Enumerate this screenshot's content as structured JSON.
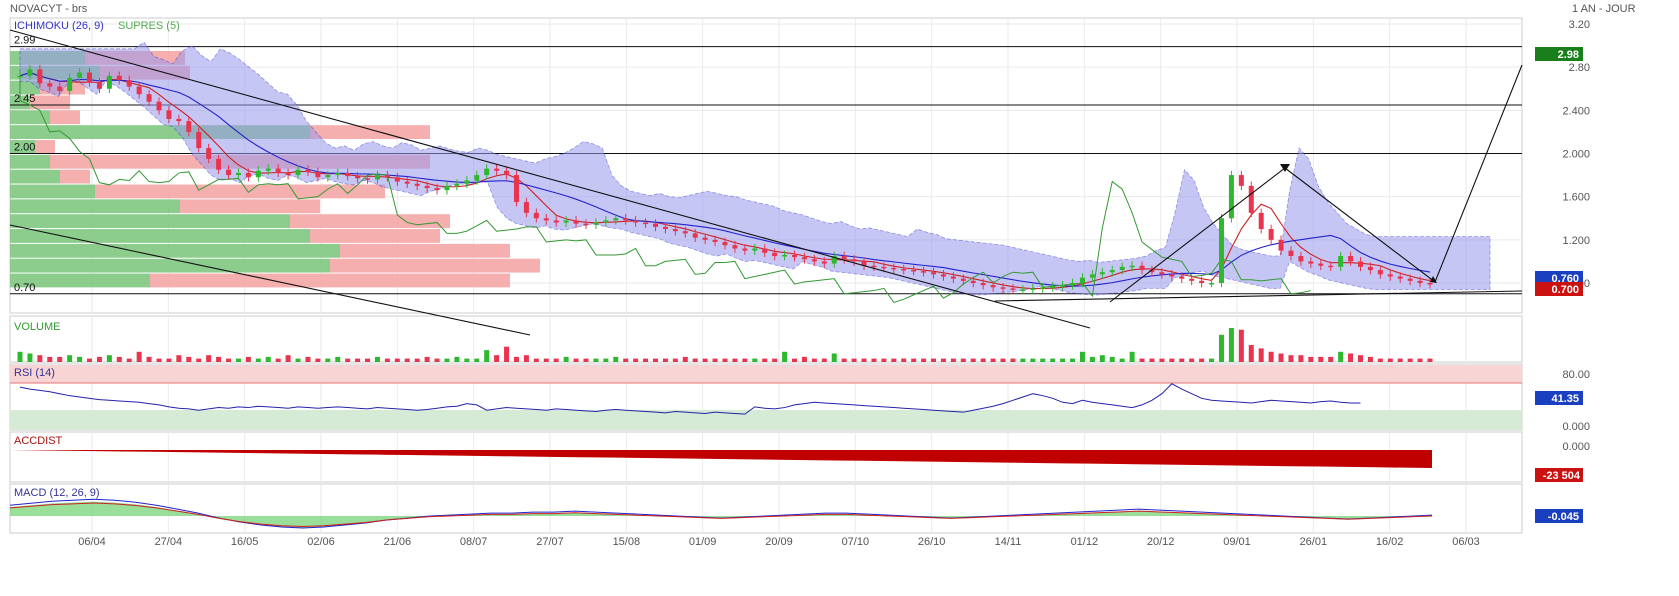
{
  "header": {
    "title": "NOVACYT - brs",
    "period": "1 AN - JOUR"
  },
  "panels": {
    "price": {
      "legend": [
        {
          "label": "ICHIMOKU (26, 9)",
          "color": "#3333cc"
        },
        {
          "label": "SUPRES (5)",
          "color": "#55aa55"
        }
      ],
      "axis_ticks": [
        "3.20",
        "2.80",
        "2.400",
        "2.000",
        "1.600",
        "1.200",
        "0.800"
      ],
      "level_labels": [
        "2.99",
        "2.45",
        "2.00",
        "0.70"
      ],
      "badges": [
        {
          "text": "2.98",
          "color": "#1a7f1a"
        },
        {
          "text": "0.760",
          "color": "#1a3fbf"
        },
        {
          "text": "0.700",
          "color": "#cc1111"
        }
      ]
    },
    "volume": {
      "label": "VOLUME"
    },
    "rsi": {
      "label": "RSI (14)",
      "ticks": [
        "80.00",
        "0.000"
      ],
      "badge": "41.35",
      "badge_color": "#1a3fbf"
    },
    "accdist": {
      "label": "ACCDIST",
      "ticks": [
        "0.000"
      ],
      "badge": "-23 504",
      "badge_color": "#cc1111"
    },
    "macd": {
      "label": "MACD (12, 26, 9)",
      "badge": "-0.045",
      "badge_color": "#1a3fbf"
    }
  },
  "x_axis": {
    "labels": [
      "06/04",
      "27/04",
      "16/05",
      "02/06",
      "21/06",
      "08/07",
      "27/07",
      "15/08",
      "01/09",
      "20/09",
      "07/10",
      "26/10",
      "14/11",
      "01/12",
      "20/12",
      "09/01",
      "26/01",
      "16/02",
      "06/03"
    ]
  },
  "colors": {
    "up": "#2eb82e",
    "down": "#e8344e",
    "cloud": "#9999ee",
    "tenkan": "#cc2222",
    "kijun": "#2222cc",
    "chikou": "#339933",
    "profile_up": "#7fc77f",
    "profile_down": "#f4a6a6"
  },
  "chart_data": {
    "type": "candlestick",
    "title": "NOVACYT - brs",
    "ylim": [
      0.68,
      3.32
    ],
    "close": [
      2.72,
      2.78,
      2.65,
      2.62,
      2.58,
      2.7,
      2.75,
      2.66,
      2.6,
      2.72,
      2.68,
      2.62,
      2.55,
      2.48,
      2.4,
      2.32,
      2.3,
      2.2,
      2.05,
      1.95,
      1.85,
      1.8,
      1.82,
      1.78,
      1.84,
      1.86,
      1.82,
      1.8,
      1.85,
      1.83,
      1.78,
      1.8,
      1.82,
      1.79,
      1.77,
      1.76,
      1.8,
      1.78,
      1.74,
      1.72,
      1.7,
      1.68,
      1.66,
      1.7,
      1.72,
      1.75,
      1.8,
      1.86,
      1.84,
      1.8,
      1.55,
      1.45,
      1.4,
      1.38,
      1.36,
      1.38,
      1.35,
      1.34,
      1.36,
      1.38,
      1.4,
      1.38,
      1.36,
      1.35,
      1.32,
      1.3,
      1.28,
      1.26,
      1.22,
      1.2,
      1.18,
      1.15,
      1.12,
      1.1,
      1.12,
      1.08,
      1.05,
      1.06,
      1.04,
      1.02,
      1.0,
      0.98,
      1.05,
      1.02,
      1.0,
      0.96,
      0.95,
      0.94,
      0.93,
      0.92,
      0.91,
      0.9,
      0.88,
      0.86,
      0.84,
      0.82,
      0.8,
      0.78,
      0.76,
      0.75,
      0.74,
      0.74,
      0.75,
      0.76,
      0.77,
      0.78,
      0.8,
      0.85,
      0.88,
      0.9,
      0.92,
      0.95,
      0.96,
      0.92,
      0.9,
      0.88,
      0.86,
      0.84,
      0.82,
      0.8,
      0.8,
      1.4,
      1.8,
      1.7,
      1.45,
      1.3,
      1.2,
      1.1,
      1.05,
      1.0,
      0.98,
      0.96,
      0.95,
      1.05,
      1.0,
      0.95,
      0.92,
      0.88,
      0.86,
      0.84,
      0.82,
      0.8,
      0.79
    ],
    "volume": [
      0.3,
      0.25,
      0.2,
      0.15,
      0.15,
      0.2,
      0.15,
      0.1,
      0.15,
      0.2,
      0.15,
      0.1,
      0.3,
      0.15,
      0.1,
      0.1,
      0.2,
      0.15,
      0.1,
      0.2,
      0.15,
      0.1,
      0.1,
      0.15,
      0.1,
      0.15,
      0.1,
      0.2,
      0.1,
      0.15,
      0.1,
      0.1,
      0.15,
      0.1,
      0.1,
      0.1,
      0.15,
      0.1,
      0.1,
      0.1,
      0.1,
      0.15,
      0.1,
      0.1,
      0.15,
      0.1,
      0.1,
      0.35,
      0.2,
      0.45,
      0.15,
      0.2,
      0.1,
      0.1,
      0.1,
      0.15,
      0.1,
      0.1,
      0.1,
      0.1,
      0.15,
      0.1,
      0.1,
      0.1,
      0.1,
      0.1,
      0.1,
      0.15,
      0.1,
      0.1,
      0.1,
      0.1,
      0.1,
      0.1,
      0.1,
      0.1,
      0.1,
      0.3,
      0.1,
      0.15,
      0.1,
      0.1,
      0.25,
      0.1,
      0.1,
      0.1,
      0.1,
      0.1,
      0.1,
      0.1,
      0.1,
      0.1,
      0.1,
      0.1,
      0.1,
      0.1,
      0.1,
      0.1,
      0.1,
      0.1,
      0.1,
      0.1,
      0.1,
      0.1,
      0.1,
      0.1,
      0.1,
      0.3,
      0.15,
      0.2,
      0.15,
      0.1,
      0.3,
      0.1,
      0.1,
      0.1,
      0.1,
      0.1,
      0.1,
      0.1,
      0.1,
      0.8,
      1.0,
      0.95,
      0.5,
      0.4,
      0.3,
      0.25,
      0.2,
      0.2,
      0.15,
      0.15,
      0.15,
      0.3,
      0.25,
      0.2,
      0.15,
      0.1,
      0.1,
      0.1,
      0.1,
      0.1,
      0.1
    ],
    "rsi": [
      65,
      62,
      60,
      58,
      55,
      52,
      50,
      48,
      46,
      45,
      44,
      43,
      42,
      40,
      38,
      35,
      33,
      32,
      30,
      32,
      34,
      33,
      35,
      34,
      36,
      35,
      34,
      33,
      35,
      34,
      33,
      34,
      35,
      34,
      33,
      32,
      34,
      33,
      32,
      31,
      30,
      31,
      33,
      35,
      36,
      40,
      38,
      30,
      32,
      34,
      33,
      32,
      31,
      30,
      32,
      31,
      30,
      29,
      28,
      30,
      31,
      30,
      29,
      28,
      27,
      26,
      28,
      27,
      26,
      25,
      27,
      26,
      25,
      24,
      35,
      33,
      32,
      34,
      38,
      40,
      42,
      41,
      40,
      39,
      38,
      37,
      36,
      35,
      34,
      33,
      32,
      31,
      30,
      29,
      28,
      27,
      30,
      33,
      36,
      40,
      45,
      50,
      55,
      52,
      48,
      42,
      40,
      45,
      42,
      40,
      38,
      36,
      34,
      38,
      45,
      55,
      70,
      62,
      55,
      48,
      45,
      44,
      43,
      42,
      41,
      43,
      45,
      44,
      43,
      42,
      41,
      43,
      44,
      42,
      41,
      41
    ],
    "accdist": [
      0,
      -0.5,
      -1,
      -1.5,
      -2,
      -2.5,
      -3,
      -3.5,
      -4,
      -4.5,
      -5,
      -5.5,
      -6,
      -6.5,
      -7,
      -7.5,
      -8,
      -8.5,
      -9,
      -9.5,
      -10,
      -10.5,
      -11,
      -11.5,
      -12,
      -12.5,
      -13,
      -13.5,
      -14,
      -14.5,
      -15,
      -15.5,
      -16,
      -16.5,
      -17,
      -17.5,
      -18,
      -18.5,
      -19,
      -19.5,
      -20,
      -20.5,
      -21,
      -21.5,
      -22,
      -22.5,
      -23,
      -23.5,
      -24,
      -24.5,
      -25
    ],
    "macd_hist": [
      0.1,
      0.12,
      0.14,
      0.15,
      0.16,
      0.15,
      0.13,
      0.1,
      0.06,
      0.02,
      -0.03,
      -0.07,
      -0.1,
      -0.12,
      -0.13,
      -0.12,
      -0.1,
      -0.08,
      -0.05,
      -0.03,
      -0.01,
      0.0,
      0.01,
      0.02,
      0.02,
      0.03,
      0.03,
      0.04,
      0.03,
      0.02,
      0.01,
      0.0,
      -0.01,
      -0.02,
      -0.03,
      -0.02,
      -0.01,
      0.0,
      0.01,
      0.02,
      0.02,
      0.01,
      0.0,
      -0.01,
      -0.02,
      -0.03,
      -0.02,
      -0.01,
      0.0,
      0.01,
      0.02,
      0.03,
      0.04,
      0.05,
      0.06,
      0.05,
      0.04,
      0.03,
      0.02,
      0.01,
      0.0,
      -0.01,
      -0.02,
      -0.03,
      -0.04,
      -0.03,
      -0.02,
      -0.01,
      0.0
    ],
    "levels": [
      2.99,
      2.45,
      2.0,
      0.7
    ]
  }
}
